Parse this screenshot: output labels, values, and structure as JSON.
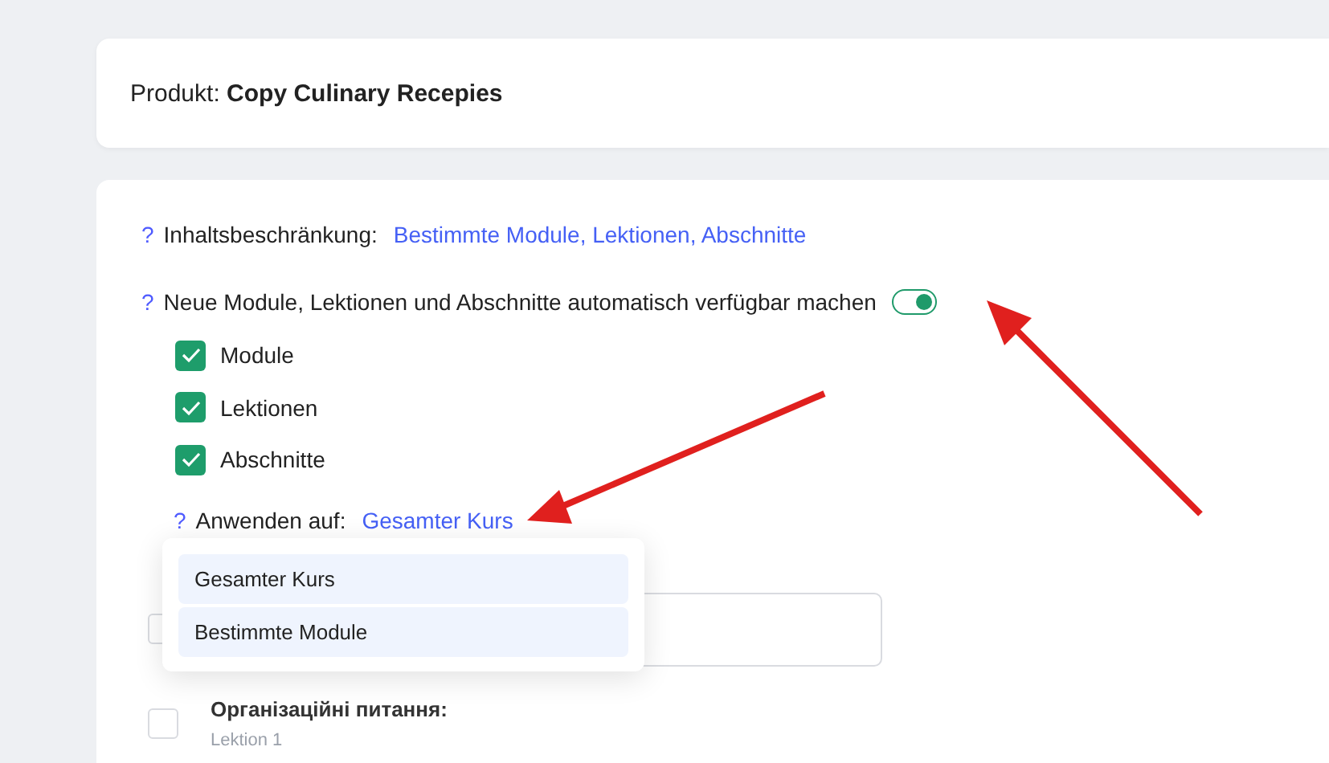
{
  "product_header": {
    "text": "Produkt: **Copy Culinary Recepies**"
  },
  "settings": {
    "restriction": {
      "help": "?",
      "label": "Inhaltsbeschränkung:",
      "value": "Bestimmte Module, Lektionen, Abschnitte"
    },
    "auto_available": {
      "help": "?",
      "label": "Neue Module, Lektionen und Abschnitte automatisch verfügbar machen",
      "on": true
    },
    "types": [
      {
        "label": "Module",
        "checked": true
      },
      {
        "label": "Lektionen",
        "checked": true
      },
      {
        "label": "Abschnitte",
        "checked": true
      }
    ],
    "apply_to": {
      "help": "?",
      "label": "Anwenden auf:",
      "value": "Gesamter Kurs",
      "options": [
        {
          "label": "Gesamter Kurs"
        },
        {
          "label": "Bestimmte Module"
        }
      ]
    }
  },
  "items": [
    {
      "kind": "input",
      "checked": false
    },
    {
      "kind": "lesson",
      "checked": false,
      "title": "Організаційні питання:",
      "subtitle": "Lektion 1"
    }
  ]
}
